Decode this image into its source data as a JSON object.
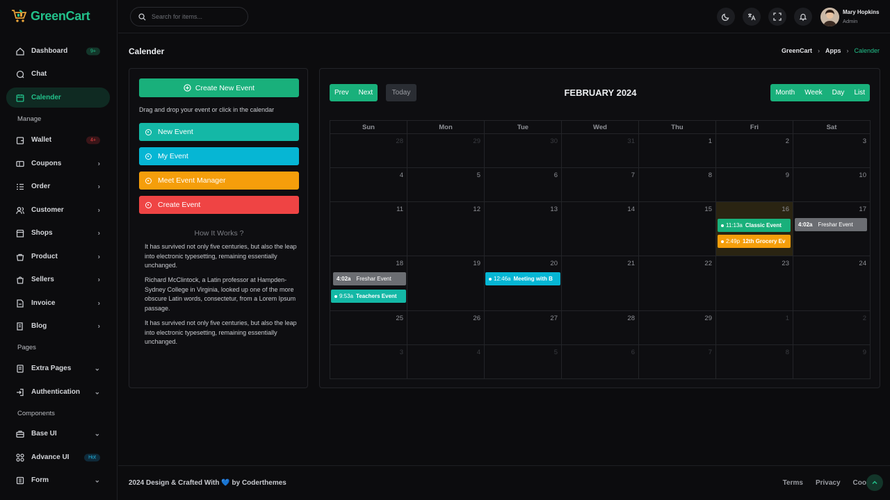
{
  "brand": {
    "name": "GreenCart",
    "accent": "#22c08a"
  },
  "sidebar": {
    "items": [
      {
        "label": "Dashboard",
        "badge": "9+",
        "icon": "home-icon"
      },
      {
        "label": "Chat",
        "icon": "chat-icon"
      },
      {
        "label": "Calender",
        "icon": "calendar-icon",
        "active": true
      },
      {
        "label": "Wallet",
        "badge": "4+",
        "icon": "wallet-icon"
      },
      {
        "label": "Coupons",
        "icon": "ticket-icon"
      },
      {
        "label": "Order",
        "icon": "list-icon"
      },
      {
        "label": "Customer",
        "icon": "users-icon"
      },
      {
        "label": "Shops",
        "icon": "store-icon"
      },
      {
        "label": "Product",
        "icon": "box-icon"
      },
      {
        "label": "Sellers",
        "icon": "bag-icon"
      },
      {
        "label": "Invoice",
        "icon": "file-icon"
      },
      {
        "label": "Blog",
        "icon": "blog-icon"
      },
      {
        "label": "Extra Pages",
        "icon": "pages-icon"
      },
      {
        "label": "Authentication",
        "icon": "login-icon"
      },
      {
        "label": "Base UI",
        "icon": "briefcase-icon"
      },
      {
        "label": "Advance UI",
        "badge": "Hot",
        "icon": "grid-icon"
      },
      {
        "label": "Form",
        "icon": "form-icon"
      }
    ],
    "sections": {
      "manage": "Manage",
      "pages": "Pages",
      "components": "Components"
    }
  },
  "topbar": {
    "search_placeholder": "Search for items...",
    "user_name": "Mary Hopkins",
    "user_role": "Admin"
  },
  "page": {
    "title": "Calender",
    "breadcrumb": [
      "GreenCart",
      "Apps",
      "Calender"
    ]
  },
  "left_panel": {
    "create_label": "Create New Event",
    "hint": "Drag and drop your event or click in the calendar",
    "events": [
      {
        "label": "New Event",
        "color": "#14b8a6"
      },
      {
        "label": "My Event",
        "color": "#06b6d4"
      },
      {
        "label": "Meet Event Manager",
        "color": "#f59e0b"
      },
      {
        "label": "Create Event",
        "color": "#ef4444"
      }
    ],
    "how_title": "How It Works ?",
    "paragraphs": [
      "It has survived not only five centuries, but also the leap into electronic typesetting, remaining essentially unchanged.",
      "Richard McClintock, a Latin professor at Hampden-Sydney College in Virginia, looked up one of the more obscure Latin words, consectetur, from a Lorem Ipsum passage.",
      "It has survived not only five centuries, but also the leap into electronic typesetting, remaining essentially unchanged."
    ]
  },
  "calendar": {
    "title": "FEBRUARY 2024",
    "prev": "Prev",
    "next": "Next",
    "today": "Today",
    "views": [
      "Month",
      "Week",
      "Day",
      "List"
    ],
    "weekdays": [
      "Sun",
      "Mon",
      "Tue",
      "Wed",
      "Thu",
      "Fri",
      "Sat"
    ],
    "days": [
      "28",
      "29",
      "30",
      "31",
      "1",
      "2",
      "3",
      "4",
      "5",
      "6",
      "7",
      "8",
      "9",
      "10",
      "11",
      "12",
      "13",
      "14",
      "15",
      "16",
      "17",
      "18",
      "19",
      "20",
      "21",
      "22",
      "23",
      "24",
      "25",
      "26",
      "27",
      "28",
      "29",
      "1",
      "2",
      "3",
      "4",
      "5",
      "6",
      "7",
      "8",
      "9"
    ],
    "events": [
      {
        "time": "11:13a",
        "title": "Classic Event",
        "color": "#19b07b"
      },
      {
        "time": "2:49p",
        "title": "12th Grocery Ev",
        "color": "#f59e0b"
      },
      {
        "time": "4:02a",
        "title": "Freshar Event",
        "color": "#6b6d72"
      },
      {
        "time": "4:02a",
        "title": "Freshar Event",
        "color": "#6b6d72"
      },
      {
        "time": "9:53a",
        "title": "Teachers Event",
        "color": "#14b8a6"
      },
      {
        "time": "12:46a",
        "title": "Meeting with B",
        "color": "#06b6d4"
      }
    ]
  },
  "footer": {
    "text": "2024 Design & Crafted With 💙 by Coderthemes",
    "links": [
      "Terms",
      "Privacy",
      "Coo"
    ]
  }
}
